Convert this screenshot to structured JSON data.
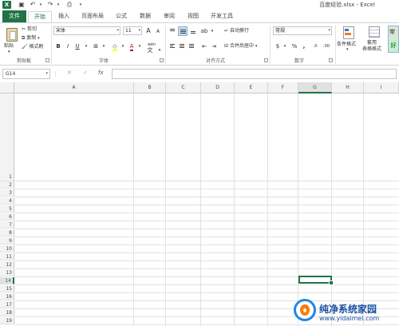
{
  "titlebar": {
    "app_icon_label": "X",
    "title": "百度经验.xlsx - Excel"
  },
  "tabs": [
    "文件",
    "开始",
    "插入",
    "页面布局",
    "公式",
    "数据",
    "审阅",
    "视图",
    "开发工具"
  ],
  "ribbon": {
    "clipboard": {
      "paste": "粘贴",
      "cut": "剪切",
      "copy": "复制",
      "format_painter": "格式刷",
      "label": "剪贴板"
    },
    "font": {
      "name": "宋体",
      "size": "11",
      "grow": "A",
      "shrink": "A",
      "bold": "B",
      "italic": "I",
      "underline": "U",
      "color_a": "A",
      "wen": "wén",
      "label": "字体"
    },
    "alignment": {
      "wrap_text": "自动换行",
      "merge_center": "合并后居中",
      "label": "对齐方式"
    },
    "number": {
      "format": "常规",
      "percent": "%",
      "comma": ",",
      "inc_decimal": ".0",
      "dec_decimal": ".00",
      "label": "数字"
    },
    "styles": {
      "conditional": "条件格式",
      "table_format_1": "套用",
      "table_format_2": "表格格式",
      "normal": "常",
      "good": "好"
    }
  },
  "formula_bar": {
    "name_box": "G14",
    "cancel": "✕",
    "enter": "✓",
    "fx": "fx",
    "value": ""
  },
  "columns": [
    "A",
    "B",
    "C",
    "D",
    "E",
    "F",
    "G",
    "H",
    "I"
  ],
  "rows": [
    "1",
    "2",
    "3",
    "4",
    "5",
    "6",
    "7",
    "8",
    "9",
    "10",
    "11",
    "12",
    "13",
    "14",
    "15",
    "16",
    "17",
    "18",
    "19"
  ],
  "selected_cell": "G14",
  "watermark": {
    "text": "纯净系统家园",
    "url": "www.yidaimei.com"
  },
  "colors": {
    "excel_green": "#217346",
    "grid": "#e1e1e1",
    "header_bg": "#f3f3f3"
  }
}
